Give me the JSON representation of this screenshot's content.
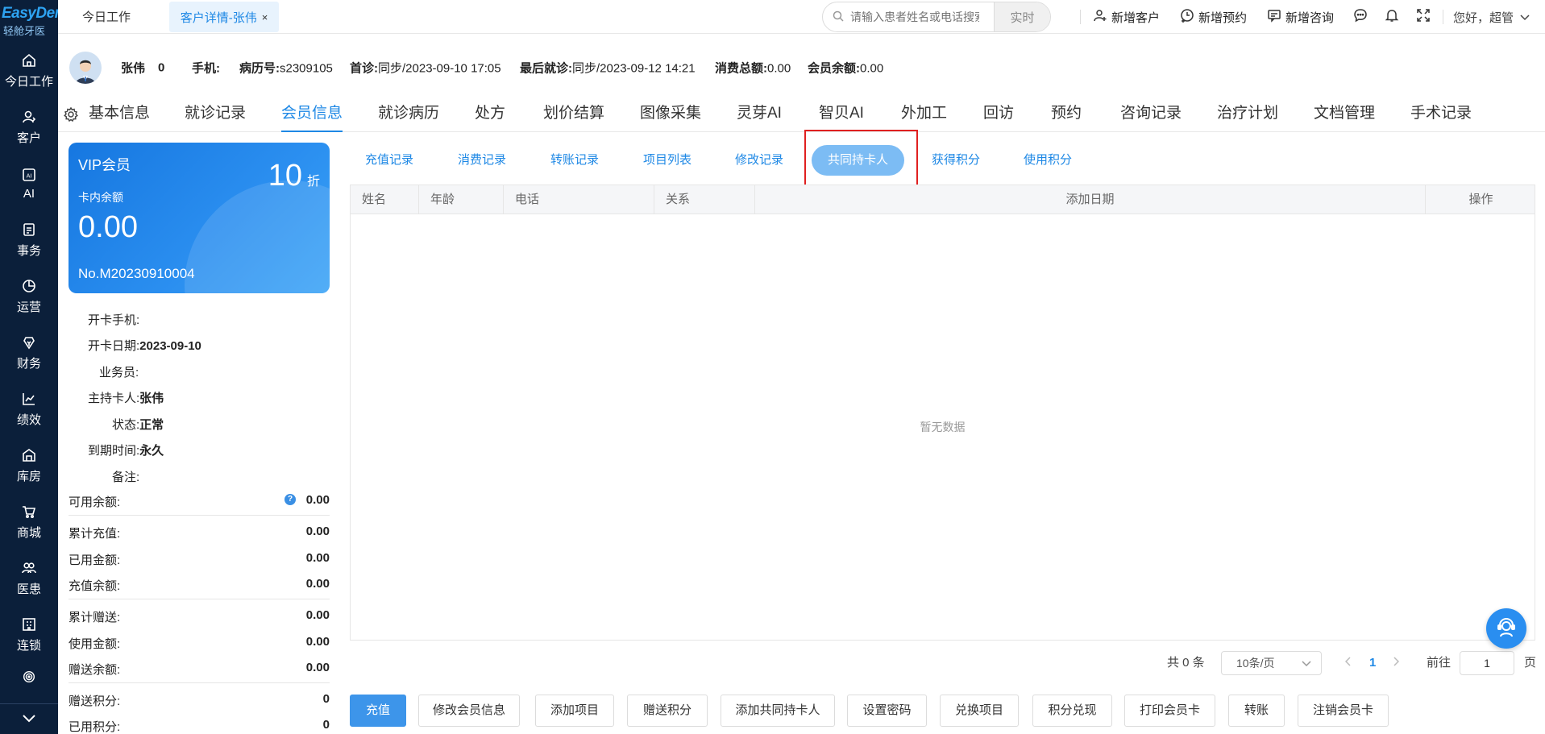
{
  "logo": {
    "line1": "EasyDent",
    "line2": "轻舱牙医"
  },
  "nav": {
    "items": [
      {
        "label": "今日工作",
        "icon": "home-icon"
      },
      {
        "label": "客户",
        "icon": "user-icon"
      },
      {
        "label": "AI",
        "icon": "ai-icon"
      },
      {
        "label": "事务",
        "icon": "task-icon"
      },
      {
        "label": "运营",
        "icon": "pie-chart-icon"
      },
      {
        "label": "财务",
        "icon": "finance-icon"
      },
      {
        "label": "绩效",
        "icon": "line-chart-icon"
      },
      {
        "label": "库房",
        "icon": "warehouse-icon"
      },
      {
        "label": "商城",
        "icon": "cart-icon"
      },
      {
        "label": "医患",
        "icon": "people-icon"
      },
      {
        "label": "连锁",
        "icon": "building-icon"
      }
    ]
  },
  "topbar": {
    "tab_today": "今日工作",
    "tab_customer": "客户详情-张伟",
    "tab_close": "×",
    "search_placeholder": "请输入患者姓名或电话搜索",
    "search_mode": "实时",
    "new_customer": "新增客户",
    "new_appointment": "新增预约",
    "new_consult": "新增咨询",
    "greeting": "您好，超管"
  },
  "patient": {
    "name": "张伟",
    "count": "0",
    "phone_label": "手机:",
    "phone": "",
    "record_label": "病历号:",
    "record": "s2309105",
    "first_visit_label": "首诊:",
    "first_visit": "同步/2023-09-10 17:05",
    "last_visit_label": "最后就诊:",
    "last_visit": "同步/2023-09-12 14:21",
    "total_spend_label": "消费总额:",
    "total_spend": "0.00",
    "member_balance_label": "会员余额:",
    "member_balance": "0.00"
  },
  "main_tabs": [
    "基本信息",
    "就诊记录",
    "会员信息",
    "就诊病历",
    "处方",
    "划价结算",
    "图像采集",
    "灵芽AI",
    "智贝AI",
    "外加工",
    "回访",
    "预约",
    "咨询记录",
    "治疗计划",
    "文档管理",
    "手术记录"
  ],
  "card": {
    "level": "VIP会员",
    "discount": "10",
    "discount_unit": "折",
    "balance_label": "卡内余额",
    "balance": "0.00",
    "number": "No.M20230910004"
  },
  "card_info": {
    "open_phone_label": "开卡手机:",
    "open_phone": "",
    "open_date_label": "开卡日期:",
    "open_date": "2023-09-10",
    "salesperson_label": "业务员:",
    "salesperson": "",
    "holder_label": "主持卡人:",
    "holder": "张伟",
    "status_label": "状态:",
    "status": "正常",
    "expire_label": "到期时间:",
    "expire": "永久",
    "remark_label": "备注:",
    "remark": ""
  },
  "stats": [
    {
      "label": "可用余额:",
      "value": "0.00"
    },
    {
      "label": "累计充值:",
      "value": "0.00"
    },
    {
      "label": "已用金额:",
      "value": "0.00"
    },
    {
      "label": "充值余额:",
      "value": "0.00"
    },
    {
      "label": "累计赠送:",
      "value": "0.00"
    },
    {
      "label": "使用金额:",
      "value": "0.00"
    },
    {
      "label": "赠送余额:",
      "value": "0.00"
    },
    {
      "label": "赠送积分:",
      "value": "0"
    },
    {
      "label": "已用积分:",
      "value": "0"
    }
  ],
  "sub_tabs": [
    "充值记录",
    "消费记录",
    "转账记录",
    "项目列表",
    "修改记录",
    "共同持卡人",
    "获得积分",
    "使用积分"
  ],
  "table": {
    "columns": [
      "姓名",
      "年龄",
      "电话",
      "关系",
      "添加日期",
      "操作"
    ],
    "empty_text": "暂无数据"
  },
  "pagination": {
    "total": "共 0 条",
    "page_size": "10条/页",
    "current_page": "1",
    "goto_label": "前往",
    "goto_value": "1",
    "page_unit": "页"
  },
  "actions": [
    "充值",
    "修改会员信息",
    "添加项目",
    "赠送积分",
    "添加共同持卡人",
    "设置密码",
    "兑换项目",
    "积分兑现",
    "打印会员卡",
    "转账",
    "注销会员卡"
  ],
  "colors": {
    "primary": "#1e88e5",
    "nav_bg": "#0b1f3a",
    "highlight": "#e02020"
  }
}
